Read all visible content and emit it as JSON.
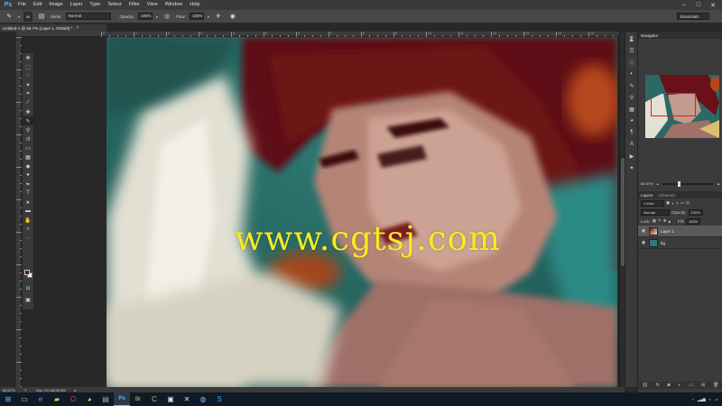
{
  "app": {
    "logo": "Ps"
  },
  "menu": [
    "File",
    "Edit",
    "Image",
    "Layer",
    "Type",
    "Select",
    "Filter",
    "View",
    "Window",
    "Help"
  ],
  "options_bar": {
    "brush_size": "36",
    "mode_label": "Mode:",
    "mode_value": "Normal",
    "opacity_label": "Opacity:",
    "opacity_value": "100%",
    "flow_label": "Flow:",
    "flow_value": "100%",
    "workspace": "Essentials"
  },
  "document": {
    "tab_title": "Untitled-1 @ 66.7% (Layer 1, RGB/8) *",
    "zoom": "66.67%",
    "doc_size": "Doc: 24.1M/35.8M"
  },
  "ruler_numbers": [
    "0",
    "1",
    "2",
    "3",
    "4",
    "5",
    "6",
    "7",
    "8",
    "9",
    "10",
    "11",
    "12",
    "13",
    "14",
    "15",
    "16",
    "17"
  ],
  "watermark": "www.cgtsj.com",
  "navigator": {
    "title": "Navigator",
    "zoom": "66.67%"
  },
  "layers_panel": {
    "tabs": [
      "Layers",
      "Channels"
    ],
    "kind_label": "Kind",
    "blend_mode": "Normal",
    "opacity_label": "Opacity:",
    "opacity_value": "100%",
    "lock_label": "Lock:",
    "fill_label": "Fill:",
    "fill_value": "100%",
    "layers": [
      {
        "name": "Layer 1",
        "selected": true
      },
      {
        "name": "bg",
        "selected": false
      }
    ]
  },
  "colors": {
    "foreground": "#5a1a1a",
    "background": "#f0f0f0",
    "watermark": "#f7ea1f",
    "nav_box": "#e02020"
  }
}
